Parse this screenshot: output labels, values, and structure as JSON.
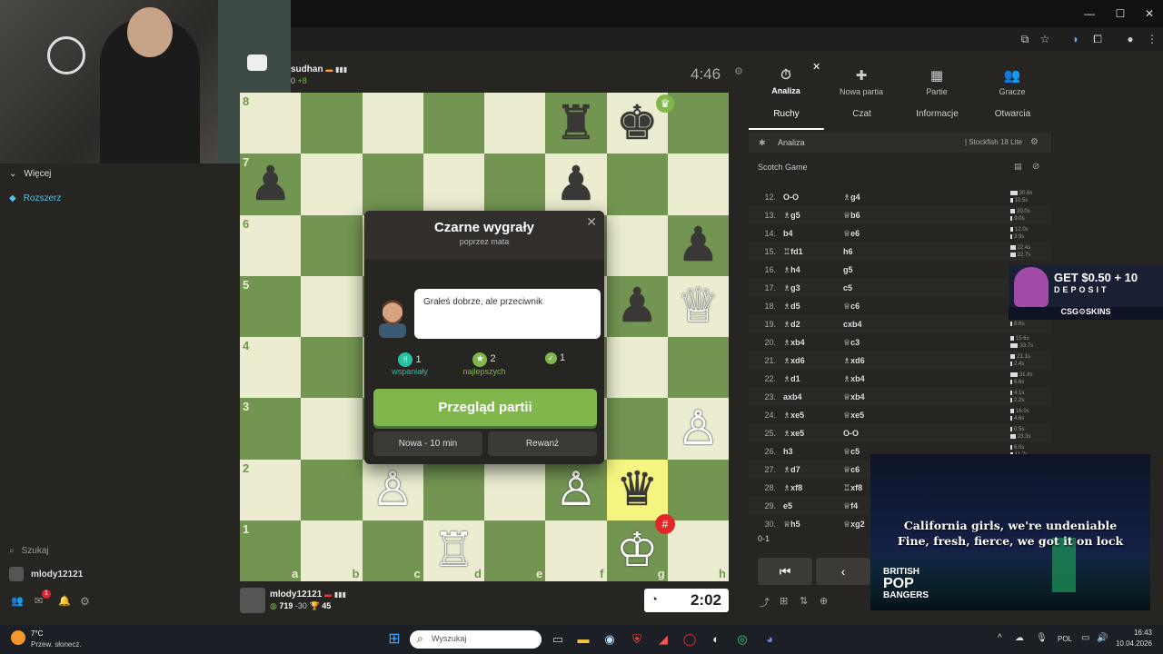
{
  "browser": {
    "window_controls": [
      "—",
      "☐",
      "✕"
    ]
  },
  "sidebar": {
    "more_label": "Więcej",
    "extend_label": "Rozszerz",
    "search_label": "Szukaj",
    "username": "mlody12121",
    "notification_count": "1"
  },
  "top_player": {
    "name": "sudhan",
    "rating_diff": "0",
    "plus": "+8",
    "clock": "4:46"
  },
  "bottom_player": {
    "name": "mlody12121",
    "rating": "719",
    "rating_change": "-30",
    "cups": "45",
    "clock": "2:02"
  },
  "board": {
    "files": [
      "a",
      "b",
      "c",
      "d",
      "e",
      "f",
      "g",
      "h"
    ],
    "ranks": [
      "8",
      "7",
      "6",
      "5",
      "4",
      "3",
      "2",
      "1"
    ],
    "pieces": [
      {
        "sq": "f8",
        "glyph": "♜",
        "color": "b"
      },
      {
        "sq": "g8",
        "glyph": "♚",
        "color": "b"
      },
      {
        "sq": "a7",
        "glyph": "♟",
        "color": "b"
      },
      {
        "sq": "f7",
        "glyph": "♟",
        "color": "b"
      },
      {
        "sq": "h6",
        "glyph": "♟",
        "color": "b"
      },
      {
        "sq": "g5",
        "glyph": "♟",
        "color": "b"
      },
      {
        "sq": "h5",
        "glyph": "♕",
        "color": "w"
      },
      {
        "sq": "h3",
        "glyph": "♙",
        "color": "w"
      },
      {
        "sq": "c2",
        "glyph": "♙",
        "color": "w"
      },
      {
        "sq": "f2",
        "glyph": "♙",
        "color": "w"
      },
      {
        "sq": "g2",
        "glyph": "♛",
        "color": "b"
      },
      {
        "sq": "d1",
        "glyph": "♖",
        "color": "w"
      },
      {
        "sq": "g1",
        "glyph": "♔",
        "color": "w"
      }
    ],
    "highlight": "g2"
  },
  "modal": {
    "title": "Czarne wygrały",
    "subtitle": "poprzez mata",
    "close": "✕",
    "coach_text": "Grałeś dobrze, ale przeciwnik",
    "stats": [
      {
        "count": "1",
        "label": "wspaniały"
      },
      {
        "count": "2",
        "label": "najlepszych"
      },
      {
        "count": "1",
        "label": ""
      }
    ],
    "review_button": "Przegląd partii",
    "new_game_button": "Nowa - 10 min",
    "rematch_button": "Rewanż"
  },
  "panel": {
    "tabs": [
      {
        "icon": "⏱",
        "label": "Analiza"
      },
      {
        "icon": "✚",
        "label": "Nowa partia"
      },
      {
        "icon": "▦",
        "label": "Partie"
      },
      {
        "icon": "👥",
        "label": "Gracze"
      }
    ],
    "subtabs": [
      "Ruchy",
      "Czat",
      "Informacje",
      "Otwarcia"
    ],
    "analysis_label": "Analiza",
    "engine_label": "| Stockfish 18 Lite",
    "opening": "Scotch Game",
    "result": "0-1",
    "moves": [
      {
        "n": "12.",
        "w": "O-O",
        "b": "♗g4",
        "t1": "30.6s",
        "t2": "10.5s"
      },
      {
        "n": "13.",
        "w": "♗g5",
        "b": "♕b6",
        "t1": "20.0s",
        "t2": "9.0s"
      },
      {
        "n": "14.",
        "w": "b4",
        "b": "♕e6",
        "t1": "12.0s",
        "t2": "3.9s"
      },
      {
        "n": "15.",
        "w": "♖fd1",
        "b": "h6",
        "t1": "22.4s",
        "t2": "22.7s"
      },
      {
        "n": "16.",
        "w": "♗h4",
        "b": "g5",
        "t1": "7.7s",
        "t2": ""
      },
      {
        "n": "17.",
        "w": "♗g3",
        "b": "c5",
        "t1": "",
        "t2": ""
      },
      {
        "n": "18.",
        "w": "♗d5",
        "b": "♕c6",
        "t1": "",
        "t2": ""
      },
      {
        "n": "19.",
        "w": "♗d2",
        "b": "cxb4",
        "t1": "8.6s",
        "t2": ""
      },
      {
        "n": "20.",
        "w": "♗xb4",
        "b": "♕c3",
        "t1": "15.6s",
        "t2": "33.7s"
      },
      {
        "n": "21.",
        "w": "♗xd6",
        "b": "♗xd6",
        "t1": "21.1s",
        "t2": "2.4s"
      },
      {
        "n": "22.",
        "w": "♗d1",
        "b": "♗xb4",
        "t1": "31.8s",
        "t2": "6.6s"
      },
      {
        "n": "23.",
        "w": "axb4",
        "b": "♕xb4",
        "t1": "4.1s",
        "t2": "2.2s"
      },
      {
        "n": "24.",
        "w": "♗xe5",
        "b": "♕xe5",
        "t1": "16.0s",
        "t2": "4.6s"
      },
      {
        "n": "25.",
        "w": "♗xe5",
        "b": "O-O",
        "t1": "0.5s",
        "t2": "23.3s"
      },
      {
        "n": "26.",
        "w": "h3",
        "b": "♕c5",
        "t1": "6.0s",
        "t2": "11.7s"
      },
      {
        "n": "27.",
        "w": "♗d7",
        "b": "♕c6",
        "t1": "",
        "t2": ""
      },
      {
        "n": "28.",
        "w": "♗xf8",
        "b": "♖xf8",
        "t1": "",
        "t2": ""
      },
      {
        "n": "29.",
        "w": "e5",
        "b": "♕f4",
        "t1": "",
        "t2": ""
      },
      {
        "n": "30.",
        "w": "♕h5",
        "b": "♕xg2",
        "t1": "",
        "t2": ""
      }
    ]
  },
  "ad": {
    "headline": "GET $0.50 + 10",
    "sub": "DEPOSIT",
    "brand": "CSG⚙SKINS"
  },
  "music_overlay": {
    "line1": "California girls, we're undeniable",
    "line2": "Fine, fresh, fierce, we got it on lock",
    "brand_1": "BRITISH",
    "brand_2": "POP",
    "brand_3": "BANGERS"
  },
  "taskbar": {
    "temp": "7°C",
    "weather": "Przew. słonecz.",
    "search_placeholder": "Wyszukaj",
    "lang": "POL",
    "time": "16:43",
    "date": "10.04.2026"
  },
  "colors": {
    "board_light": "#ebecd0",
    "board_dark": "#739552",
    "accent": "#81b64c",
    "highlight": "#f5f682"
  }
}
